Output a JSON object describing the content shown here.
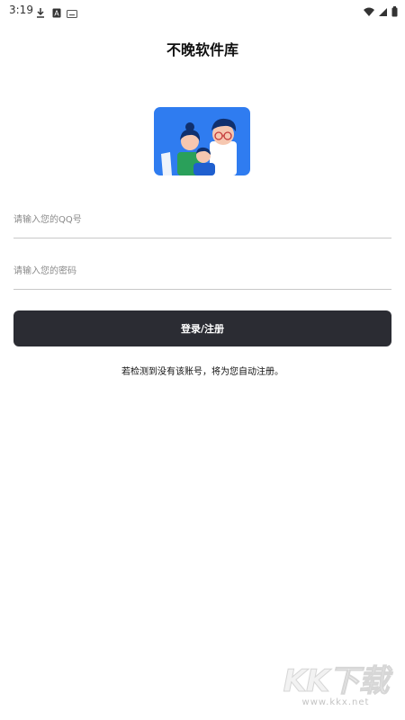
{
  "status_bar": {
    "time": "3:19",
    "left_icons": [
      "download-icon",
      "a-box-icon",
      "keyboard-icon"
    ],
    "right_icons": [
      "wifi-icon",
      "signal-icon",
      "battery-icon"
    ]
  },
  "header": {
    "title": "不晚软件库"
  },
  "illustration": {
    "name": "family-illustration",
    "bg_color": "#2f7cf0"
  },
  "form": {
    "qq_placeholder": "请输入您的QQ号",
    "qq_value": "",
    "password_placeholder": "请输入您的密码",
    "password_value": "",
    "submit_label": "登录/注册",
    "notice": "若检测到没有该账号，将为您自动注册。"
  },
  "watermark": {
    "logo_text": "KK下载",
    "url": "www.kkx.net"
  },
  "colors": {
    "button_bg": "#2b2c33",
    "divider": "#c8c8c8",
    "accent": "#2f7cf0"
  }
}
